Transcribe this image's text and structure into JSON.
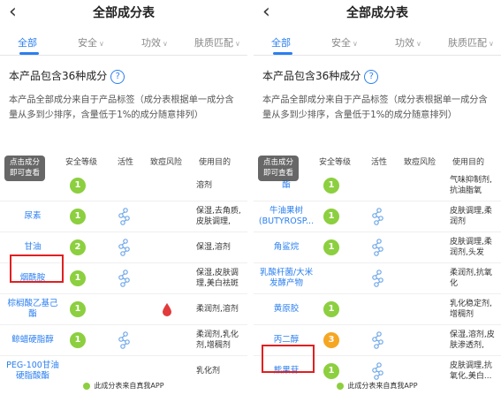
{
  "colors": {
    "accent": "#2a7ff0",
    "safe_green": "#8ccf3f",
    "safe_orange": "#f5a623",
    "highlight": "#e02020",
    "risk_red": "#e23b3b"
  },
  "left": {
    "nav": {
      "back_icon": "chevron-left-icon",
      "title": "全部成分表"
    },
    "tabs": [
      {
        "label": "全部",
        "active": true
      },
      {
        "label": "安全",
        "active": false
      },
      {
        "label": "功效",
        "active": false
      },
      {
        "label": "肤质匹配",
        "active": false
      }
    ],
    "count_text": "本产品包含36种成分",
    "description": "本产品全部成分来自于产品标签（成分表根据单一成分含量从多到少排序，含量低于1%的成分随意排列）",
    "tooltip": [
      "点击成分",
      "即可查看"
    ],
    "table_headers": [
      "安全等级",
      "活性",
      "致痘风险",
      "使用目的"
    ],
    "rows": [
      {
        "name": "",
        "safety": "1",
        "active": false,
        "risk": false,
        "purpose": "溶剂"
      },
      {
        "name": "尿素",
        "safety": "1",
        "active": true,
        "risk": false,
        "purpose": "保湿,去角质,皮肤调理,"
      },
      {
        "name": "甘油",
        "safety": "2",
        "active": true,
        "risk": false,
        "purpose": "保湿,溶剂"
      },
      {
        "name": "烟酰胺",
        "safety": "1",
        "active": true,
        "risk": false,
        "purpose": "保湿,皮肤调理,美白祛斑"
      },
      {
        "name": "棕榈酸乙基己酯",
        "safety": "1",
        "active": false,
        "risk": true,
        "purpose": "柔润剂,溶剂"
      },
      {
        "name": "鲸蜡硬脂醇",
        "safety": "1",
        "active": true,
        "risk": false,
        "purpose": "柔润剂,乳化剂,增稠剂"
      },
      {
        "name": "PEG-100甘油硬脂酸酯",
        "safety": "",
        "active": false,
        "risk": false,
        "purpose": "乳化剂"
      }
    ],
    "footer": "此成分表来自真我APP"
  },
  "right": {
    "nav": {
      "back_icon": "chevron-left-icon",
      "title": "全部成分表"
    },
    "tabs": [
      {
        "label": "全部",
        "active": true
      },
      {
        "label": "安全",
        "active": false
      },
      {
        "label": "功效",
        "active": false
      },
      {
        "label": "肤质匹配",
        "active": false
      }
    ],
    "count_text": "本产品包含36种成分",
    "description": "本产品全部成分来自于产品标签（成分表根据单一成分含量从多到少排序，含量低于1%的成分随意排列）",
    "tooltip": [
      "点击成分",
      "即可查看"
    ],
    "table_headers": [
      "安全等级",
      "活性",
      "致痘风险",
      "使用目的"
    ],
    "rows": [
      {
        "name": "酯",
        "safety": "1",
        "active": false,
        "risk": false,
        "purpose": "气味抑制剂,抗油脂氧"
      },
      {
        "name": "牛油果树(BUTYROSP...",
        "safety": "1",
        "active": true,
        "risk": false,
        "purpose": "皮肤调理,柔润剂"
      },
      {
        "name": "角鲨烷",
        "safety": "1",
        "active": true,
        "risk": false,
        "purpose": "皮肤调理,柔润剂,头发"
      },
      {
        "name": "乳酸杆菌/大米发酵产物",
        "safety": "",
        "active": true,
        "risk": false,
        "purpose": "柔润剂,抗氧化"
      },
      {
        "name": "黄原胶",
        "safety": "1",
        "active": false,
        "risk": false,
        "purpose": "乳化稳定剂,增稠剂"
      },
      {
        "name": "丙二醇",
        "safety": "3",
        "active": true,
        "risk": false,
        "purpose": "保湿,溶剂,皮肤渗透剂,"
      },
      {
        "name": "熊果苷",
        "safety": "1",
        "active": true,
        "risk": false,
        "purpose": "皮肤调理,抗氧化,美白..."
      }
    ],
    "footer": "此成分表来自真我APP"
  }
}
